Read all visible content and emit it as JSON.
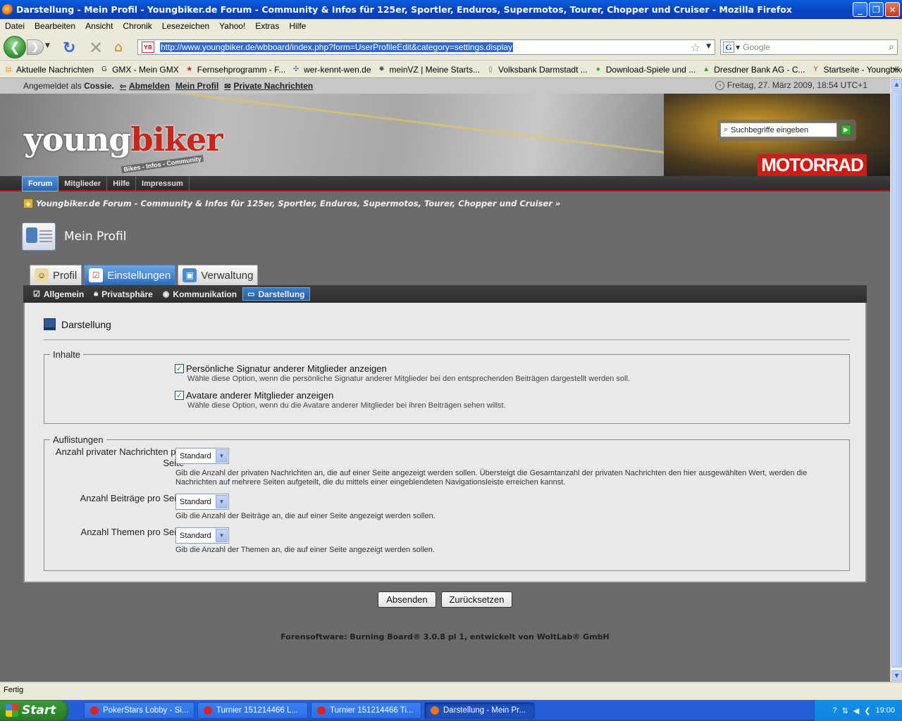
{
  "window": {
    "title": "Darstellung - Mein Profil - Youngbiker.de Forum - Community & Infos für 125er, Sportler, Enduros, Supermotos, Tourer, Chopper und Cruiser - Mozilla Firefox",
    "min": "_",
    "max": "❐",
    "close": "✕"
  },
  "menu": [
    "Datei",
    "Bearbeiten",
    "Ansicht",
    "Chronik",
    "Lesezeichen",
    "Yahoo!",
    "Extras",
    "Hilfe"
  ],
  "nav": {
    "url": "http://www.youngbiker.de/wbboard/index.php?form=UserProfileEdit&category=settings.display",
    "url_favicon": "YB",
    "search_placeholder": "Google",
    "search_engine": "G"
  },
  "bookmarks": [
    {
      "label": "Aktuelle Nachrichten",
      "icon": "rss-icon",
      "glyph": "▤",
      "color": "#e8a33a"
    },
    {
      "label": "GMX - Mein GMX",
      "icon": "gmx-icon",
      "glyph": "G",
      "color": "#333"
    },
    {
      "label": "Fernsehprogramm - F...",
      "icon": "star-icon",
      "glyph": "★",
      "color": "#d22"
    },
    {
      "label": "wer-kennt-wen.de",
      "icon": "network-icon",
      "glyph": "✣",
      "color": "#4a6fb0"
    },
    {
      "label": "meinVZ | Meine Starts...",
      "icon": "gear-icon",
      "glyph": "✹",
      "color": "#555"
    },
    {
      "label": "Volksbank Darmstadt ...",
      "icon": "page-icon",
      "glyph": "▯",
      "color": "#777"
    },
    {
      "label": "Download-Spiele und ...",
      "icon": "game-icon",
      "glyph": "●",
      "color": "#3a3"
    },
    {
      "label": "Dresdner Bank AG - C...",
      "icon": "bank-icon",
      "glyph": "▲",
      "color": "#2a2"
    },
    {
      "label": "Startseite - Youngbike...",
      "icon": "yb-icon",
      "glyph": "Y",
      "color": "#c33"
    }
  ],
  "site": {
    "logged_prefix": "Angemeldet als",
    "username": "Cossie.",
    "logout": "Abmelden",
    "my_profile": "Mein Profil",
    "messages": "Private Nachrichten",
    "date": "Freitag, 27. März 2009, 18:54 UTC+1",
    "logo_young": "young",
    "logo_biker": "biker",
    "tagline": "Bikes - Infos - Community",
    "motorrad": "MOTORRAD",
    "header_search_placeholder": "Suchbegriffe eingeben",
    "main_tabs": [
      "Forum",
      "Mitglieder",
      "Hilfe",
      "Impressum"
    ],
    "breadcrumb": "Youngbiker.de Forum - Community & Infos für 125er, Sportler, Enduros, Supermotos, Tourer, Chopper und Cruiser »",
    "page_title": "Mein Profil"
  },
  "profile_tabs": [
    {
      "label": "Profil",
      "active": false
    },
    {
      "label": "Einstellungen",
      "active": true
    },
    {
      "label": "Verwaltung",
      "active": false
    }
  ],
  "sub_tabs": [
    {
      "label": "Allgemein",
      "active": false
    },
    {
      "label": "Privatsphäre",
      "active": false
    },
    {
      "label": "Kommunikation",
      "active": false
    },
    {
      "label": "Darstellung",
      "active": true
    }
  ],
  "content": {
    "section_title": "Darstellung",
    "inhalte_legend": "Inhalte",
    "checkboxes": [
      {
        "label": "Persönliche Signatur anderer Mitglieder anzeigen",
        "desc": "Wähle diese Option, wenn die persönliche Signatur anderer Mitglieder bei den entsprechenden Beiträgen dargestellt werden soll.",
        "checked": true
      },
      {
        "label": "Avatare anderer Mitglieder anzeigen",
        "desc": "Wähle diese Option, wenn du die Avatare anderer Mitglieder bei ihren Beiträgen sehen willst.",
        "checked": true
      }
    ],
    "auflistungen_legend": "Auflistungen",
    "fields": [
      {
        "label": "Anzahl privater Nachrichten pro Seite",
        "value": "Standard",
        "desc": "Gib die Anzahl der privaten Nachrichten an, die auf einer Seite angezeigt werden sollen. Übersteigt die Gesamtanzahl der privaten Nachrichten den hier ausgewählten Wert, werden die Nachrichten auf mehrere Seiten aufgeteilt, die du mittels einer eingeblendeten Navigationsleiste erreichen kannst."
      },
      {
        "label": "Anzahl Beiträge pro Seite",
        "value": "Standard",
        "desc": "Gib die Anzahl der Beiträge an, die auf einer Seite angezeigt werden sollen."
      },
      {
        "label": "Anzahl Themen pro Seite",
        "value": "Standard",
        "desc": "Gib die Anzahl der Themen an, die auf einer Seite angezeigt werden sollen."
      }
    ],
    "submit": "Absenden",
    "reset": "Zurücksetzen",
    "footer": "Forensoftware: Burning Board® 3.0.8 pl 1, entwickelt von WoltLab® GmbH"
  },
  "status": "Fertig",
  "taskbar": {
    "start": "Start",
    "tasks": [
      {
        "label": "PokerStars Lobby - Si...",
        "active": false,
        "color": "#d22"
      },
      {
        "label": "Turnier 151214466 L...",
        "active": false,
        "color": "#d22"
      },
      {
        "label": "Turnier 151214466 Ti...",
        "active": false,
        "color": "#d22"
      },
      {
        "label": "Darstellung - Mein Pr...",
        "active": true,
        "color": "#e8761a"
      }
    ],
    "time": "19:00"
  }
}
